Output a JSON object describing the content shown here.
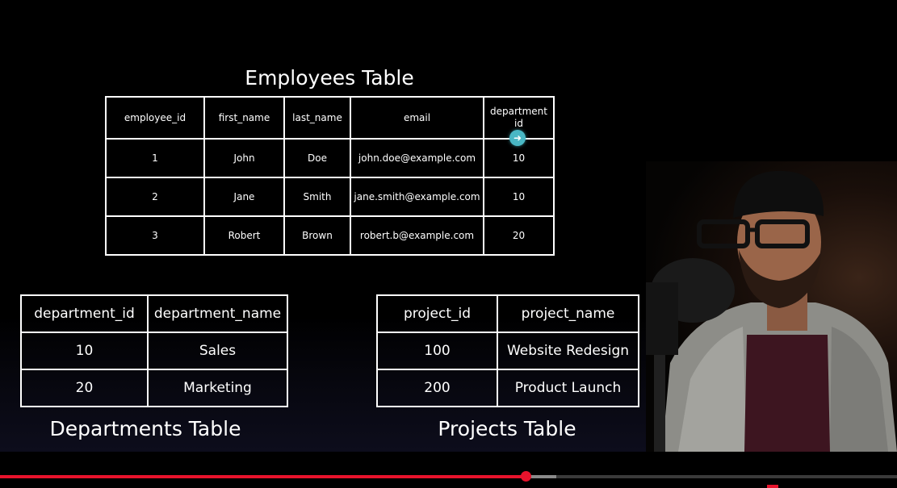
{
  "colors": {
    "background": "#000000",
    "text": "#ffffff",
    "border": "#ffffff",
    "progress_played": "#e8132c",
    "progress_buffered": "#8a8a8a",
    "cursor": "#49b7c4"
  },
  "employees": {
    "title": "Employees Table",
    "headers": [
      "employee_id",
      "first_name",
      "last_name",
      "email",
      "department\nid"
    ],
    "rows": [
      [
        "1",
        "John",
        "Doe",
        "john.doe@example.com",
        "10"
      ],
      [
        "2",
        "Jane",
        "Smith",
        "jane.smith@example.com",
        "10"
      ],
      [
        "3",
        "Robert",
        "Brown",
        "robert.b@example.com",
        "20"
      ]
    ]
  },
  "departments": {
    "title": "Departments Table",
    "headers": [
      "department_id",
      "department_name"
    ],
    "rows": [
      [
        "10",
        "Sales"
      ],
      [
        "20",
        "Marketing"
      ]
    ]
  },
  "projects": {
    "title": "Projects Table",
    "headers": [
      "project_id",
      "project_name"
    ],
    "rows": [
      [
        "100",
        "Website Redesign"
      ],
      [
        "200",
        "Product Launch"
      ]
    ]
  },
  "cursor_icon": "arrow-right-circle-icon",
  "webcam": {
    "icon": "presenter-webcam"
  },
  "video_progress": {
    "played_fraction": 0.586,
    "buffered_fraction": 0.62
  }
}
